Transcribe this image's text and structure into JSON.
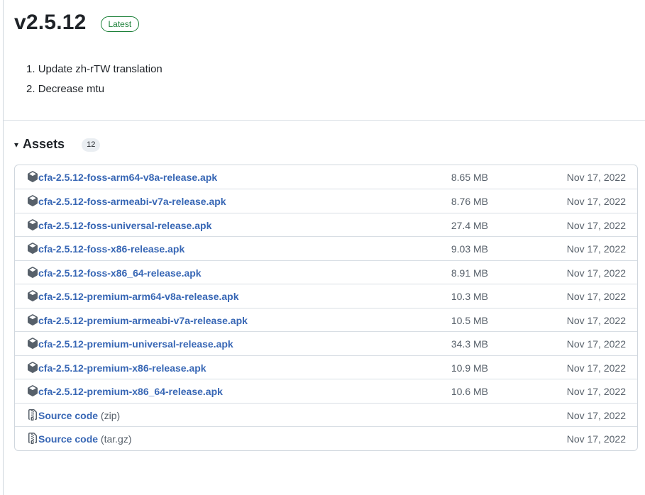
{
  "release": {
    "version": "v2.5.12",
    "badge": "Latest"
  },
  "notes": [
    "Update zh-rTW translation",
    "Decrease mtu"
  ],
  "assets": {
    "caret": "▾",
    "title": "Assets",
    "count": "12",
    "rows": [
      {
        "name": "cfa-2.5.12-foss-arm64-v8a-release.apk",
        "suffix": "",
        "size": "8.65 MB",
        "date": "Nov 17, 2022",
        "icon": "package-icon"
      },
      {
        "name": "cfa-2.5.12-foss-armeabi-v7a-release.apk",
        "suffix": "",
        "size": "8.76 MB",
        "date": "Nov 17, 2022",
        "icon": "package-icon"
      },
      {
        "name": "cfa-2.5.12-foss-universal-release.apk",
        "suffix": "",
        "size": "27.4 MB",
        "date": "Nov 17, 2022",
        "icon": "package-icon"
      },
      {
        "name": "cfa-2.5.12-foss-x86-release.apk",
        "suffix": "",
        "size": "9.03 MB",
        "date": "Nov 17, 2022",
        "icon": "package-icon"
      },
      {
        "name": "cfa-2.5.12-foss-x86_64-release.apk",
        "suffix": "",
        "size": "8.91 MB",
        "date": "Nov 17, 2022",
        "icon": "package-icon"
      },
      {
        "name": "cfa-2.5.12-premium-arm64-v8a-release.apk",
        "suffix": "",
        "size": "10.3 MB",
        "date": "Nov 17, 2022",
        "icon": "package-icon"
      },
      {
        "name": "cfa-2.5.12-premium-armeabi-v7a-release.apk",
        "suffix": "",
        "size": "10.5 MB",
        "date": "Nov 17, 2022",
        "icon": "package-icon"
      },
      {
        "name": "cfa-2.5.12-premium-universal-release.apk",
        "suffix": "",
        "size": "34.3 MB",
        "date": "Nov 17, 2022",
        "icon": "package-icon"
      },
      {
        "name": "cfa-2.5.12-premium-x86-release.apk",
        "suffix": "",
        "size": "10.9 MB",
        "date": "Nov 17, 2022",
        "icon": "package-icon"
      },
      {
        "name": "cfa-2.5.12-premium-x86_64-release.apk",
        "suffix": "",
        "size": "10.6 MB",
        "date": "Nov 17, 2022",
        "icon": "package-icon"
      },
      {
        "name": "Source code",
        "suffix": "(zip)",
        "size": "",
        "date": "Nov 17, 2022",
        "icon": "file-zip-icon"
      },
      {
        "name": "Source code",
        "suffix": "(tar.gz)",
        "size": "",
        "date": "Nov 17, 2022",
        "icon": "file-zip-icon"
      }
    ]
  },
  "colors": {
    "link": "#3867b5",
    "badge_green": "#1a7f37",
    "muted": "#57606a",
    "border": "#d0d7de"
  }
}
